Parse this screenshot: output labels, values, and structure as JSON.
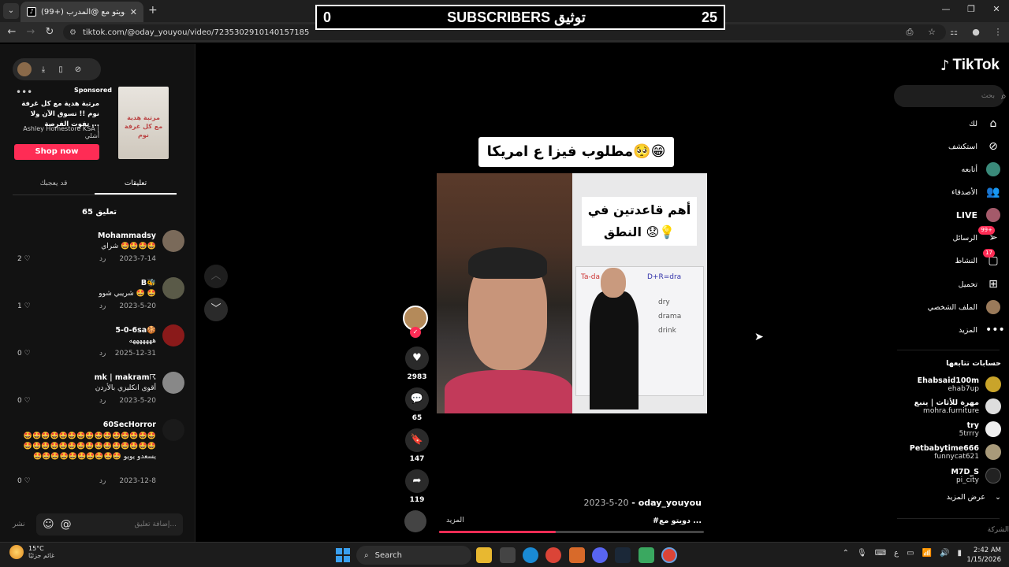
{
  "browser": {
    "tab_title": "(99+) دويتو مع @المدرب/...",
    "tab_favicon": "tiktok-icon",
    "url": "tiktok.com/@oday_youyou/video/7235302910140157185"
  },
  "overlay": {
    "left_count": "0",
    "label": "SUBSCRIBERS توثيق",
    "right_count": "25"
  },
  "ad": {
    "sponsored": "Sponsored",
    "text": "مرتبة هدية مع كل غرفة نوم !! تسوق الآن ولا تفوت الفرصة ...",
    "brand": "Ashley Homestore KSA | أشلي",
    "shop_label": "Shop now",
    "image_text": "مرتبة هدية مع كل غرفة نوم"
  },
  "comments_tabs": {
    "comments": "تعليقات",
    "you_may_like": "قد يعجبك"
  },
  "comment_count_label": "65 تعليق",
  "reply_label": "رد",
  "comments": [
    {
      "user": "Mohammadsy",
      "body": "شراي 🤩🤩🤩🤩",
      "date": "2023-7-14",
      "likes": "2"
    },
    {
      "user": "B🐝",
      "body": "شريبي شوو 🤩 🤩",
      "date": "2023-5-20",
      "likes": "1"
    },
    {
      "user": "5-0-6sa🍪",
      "body": "هههههههه",
      "date": "2025-12-31",
      "likes": "0"
    },
    {
      "user": "mk | makram☈",
      "body": "أقوى انكليزي بالأردن",
      "date": "2023-5-20",
      "likes": "0"
    },
    {
      "user": "60SecHorror",
      "body": "🤩🤩🤩🤩🤩🤩🤩🤩🤩🤩🤩🤩🤩🤩🤩🤩🤩🤩🤩🤩🤩🤩🤩🤩🤩🤩🤩🤩🤩🤩🤩🤩🤩🤩🤩🤩🤩🤩🤩🤩 يسعدو يويو",
      "date": "2023-12-8",
      "likes": "0"
    }
  ],
  "add_comment": {
    "placeholder": "إضافة تعليق...",
    "post": "نشر"
  },
  "video": {
    "caption": "مطلوب فيزا ع امريكا🥺😁",
    "card_text": "أهم قاعدتين في النطق 😟💡",
    "board_labels": [
      "Ta-da",
      "D+R=dra",
      "dry",
      "drama",
      "drink"
    ],
    "username": "oday_youyou",
    "date": "2023-5-20",
    "description": "#دويتو مع ...",
    "more": "المزيد",
    "progress": 0.44
  },
  "actions": {
    "likes": "2983",
    "comments": "65",
    "saves": "147",
    "shares": "119"
  },
  "sidebar": {
    "logo": "TikTok",
    "search_placeholder": "بحث",
    "nav": [
      {
        "label": "لك",
        "icon": "home-icon"
      },
      {
        "label": "استكشف",
        "icon": "compass-icon"
      },
      {
        "label": "أتابعه",
        "icon": "following-avatar-icon"
      },
      {
        "label": "الأصدقاء",
        "icon": "friends-icon"
      },
      {
        "label": "LIVE",
        "icon": "live-icon"
      },
      {
        "label": "الرسائل",
        "icon": "messages-icon",
        "badge": "99+"
      },
      {
        "label": "النشاط",
        "icon": "activity-icon",
        "badge": "17"
      },
      {
        "label": "تحميل",
        "icon": "upload-icon"
      },
      {
        "label": "الملف الشخصي",
        "icon": "profile-icon"
      },
      {
        "label": "المزيد",
        "icon": "more-icon"
      }
    ],
    "following_title": "حسابات تتابعها",
    "following": [
      {
        "name": "Ehabsaid100m",
        "handle": "ehab7up"
      },
      {
        "name": "مهرة للأثاث | ينبع",
        "handle": "mohra.furniture"
      },
      {
        "name": "try",
        "handle": "5trrry"
      },
      {
        "name": "Petbabytime666",
        "handle": "funnycat621"
      },
      {
        "name": "M7D_S",
        "handle": "pi_city"
      }
    ],
    "see_more": "عرض المزيد",
    "company": "الشركة"
  },
  "taskbar": {
    "weather_temp": "15°C",
    "weather_desc": "غائم جزئيًا",
    "search": "Search",
    "time": "2:42 AM",
    "date": "1/15/2026",
    "lang": "ع"
  }
}
